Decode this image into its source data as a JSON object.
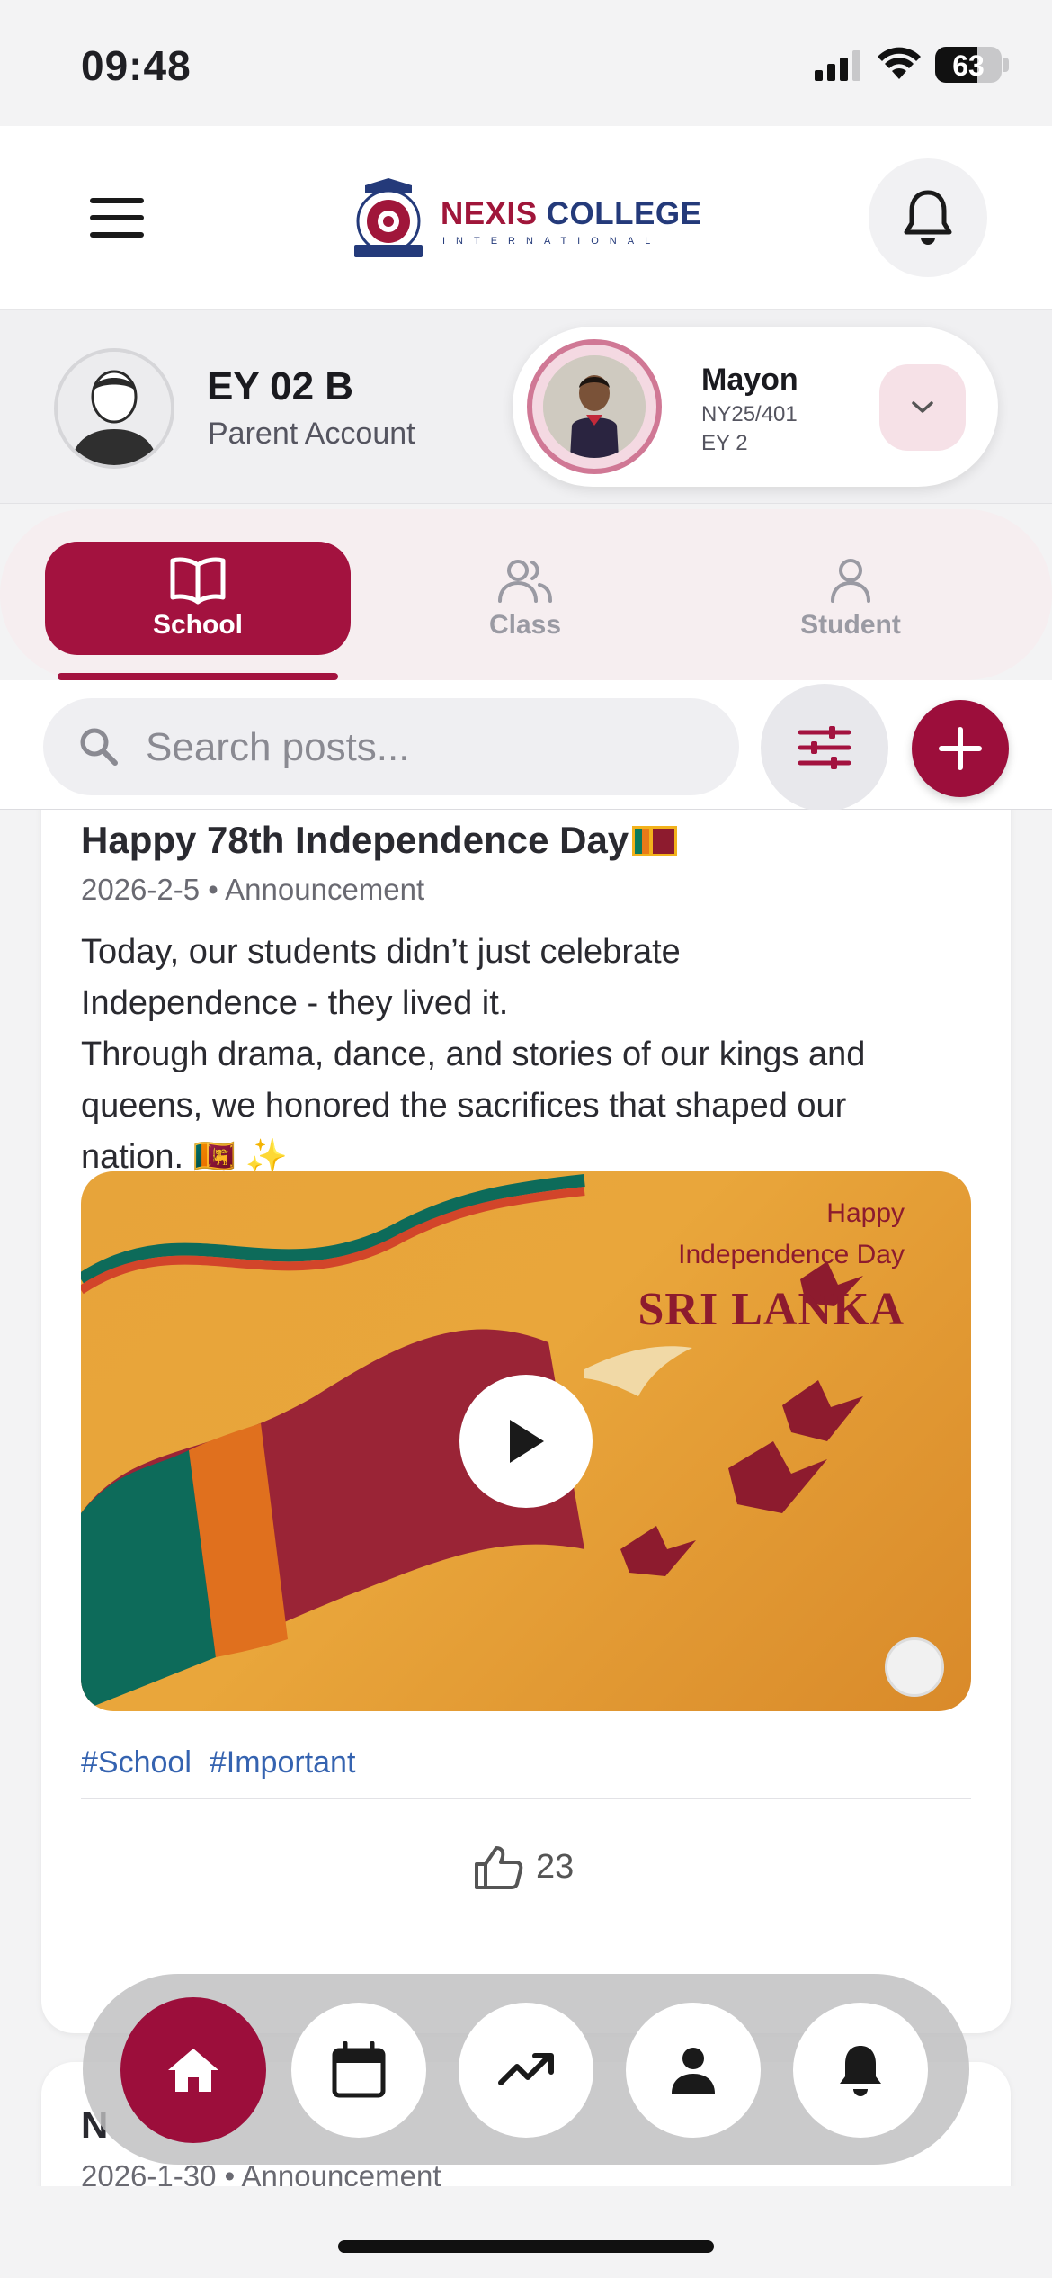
{
  "status_bar": {
    "time": "09:48",
    "battery": "63",
    "battery_level": 0.63
  },
  "header": {
    "logo_name_part1": "NEXIS",
    "logo_name_part2": "COLLEGE",
    "logo_subtitle": "INTERNATIONAL"
  },
  "profile": {
    "parent_name": "EY 02 B",
    "parent_role": "Parent Account",
    "student_name": "Mayon",
    "student_id": "NY25/401",
    "student_class": "EY 2"
  },
  "tabs": [
    {
      "label": "School",
      "active": true
    },
    {
      "label": "Class",
      "active": false
    },
    {
      "label": "Student",
      "active": false
    }
  ],
  "search": {
    "placeholder": "Search posts..."
  },
  "posts": [
    {
      "title": "Happy 78th Independence Day",
      "meta": "2026-2-5 • Announcement",
      "body": "Today, our students didn’t just celebrate\nIndependence - they lived it.\nThrough drama, dance, and stories of our kings and\nqueens, we honored the sacrifices that shaped our\nnation. 🇱🇰 ✨",
      "image": {
        "line1": "Happy",
        "line2": "Independence Day",
        "line3": "SRI LANKA"
      },
      "tags": [
        "#School",
        "#Important"
      ],
      "likes": "23"
    },
    {
      "title": "N",
      "meta": "2026-1-30 • Announcement"
    }
  ],
  "colors": {
    "brand": "#a3123f",
    "accent_blue": "#3563b0",
    "logo_blue": "#243a7a"
  },
  "icons": {
    "menu": "hamburger-icon",
    "notifications": "bell-icon",
    "dropdown": "chevron-down-icon",
    "school_tab": "book-open-icon",
    "class_tab": "users-icon",
    "student_tab": "user-icon",
    "search": "search-icon",
    "filter": "sliders-icon",
    "add": "plus-icon",
    "play": "play-icon",
    "like": "thumbs-up-icon",
    "nav": [
      "home-icon",
      "calendar-icon",
      "trending-up-icon",
      "person-icon",
      "bell-icon"
    ]
  }
}
